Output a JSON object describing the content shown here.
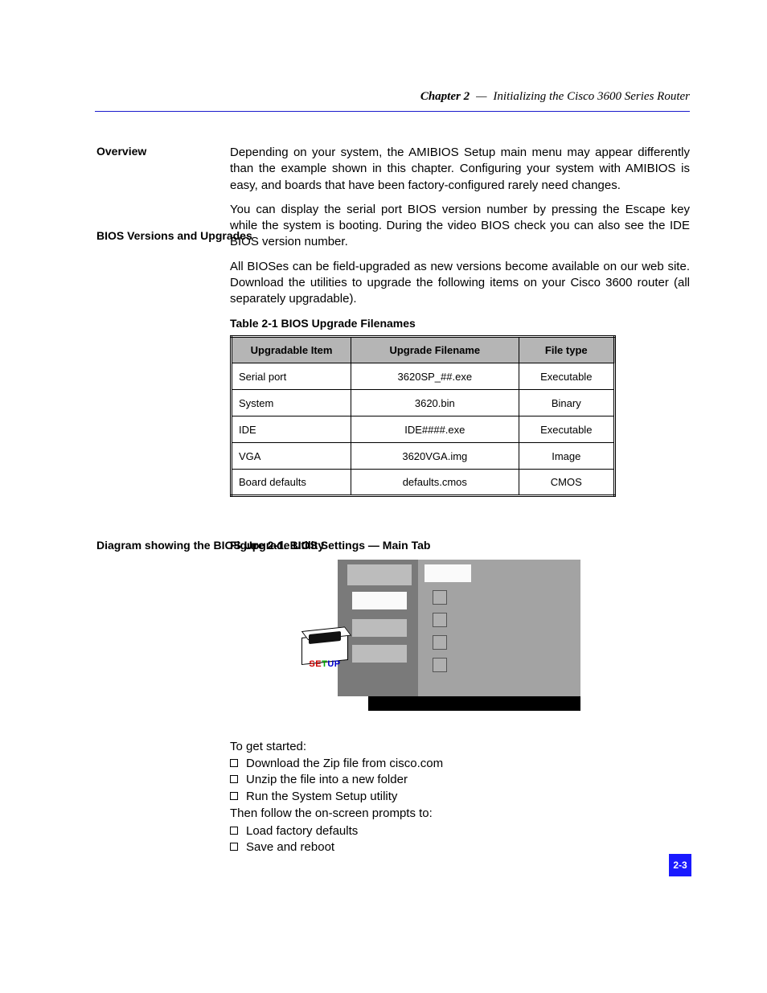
{
  "header": {
    "chapter": "Chapter 2",
    "sep": "—",
    "title": "Initializing the Cisco 3600 Series Router"
  },
  "labels": {
    "overview": "Overview",
    "bios": "BIOS Versions and Upgrades",
    "diagram": "Diagram showing the BIOS Upgrade Utility"
  },
  "paragraphs": {
    "p1": "Depending on your system, the AMIBIOS Setup main menu may appear differently than the example shown in this chapter. Configuring your system with AMIBIOS is easy, and boards that have been factory-configured rarely need changes.",
    "p2": "You can display the serial port BIOS version number by pressing the Escape key while the system is booting. During the video BIOS check you can also see the IDE BIOS version number.",
    "p3": "All BIOSes can be field-upgraded as new versions become available on our web site. Download the utilities to upgrade the following items on your Cisco 3600 router (all separately upgradable)."
  },
  "table": {
    "caption": "Table 2-1  BIOS Upgrade Filenames",
    "headers": [
      "Upgradable Item",
      "Upgrade Filename",
      "File type"
    ],
    "rows": [
      [
        "Serial port",
        "3620SP_##.exe",
        "Executable"
      ],
      [
        "System",
        "3620.bin",
        "Binary"
      ],
      [
        "IDE",
        "IDE####.exe",
        "Executable"
      ],
      [
        "VGA",
        "3620VGA.img",
        "Image"
      ],
      [
        "Board defaults",
        "defaults.cmos",
        "CMOS"
      ]
    ]
  },
  "diagram_title": "Figure 2-1.  BIOS Settings — Main Tab",
  "setup_label": "SETUP",
  "bullets": {
    "intro": "To get started:",
    "group1": [
      "Download the Zip file from cisco.com",
      "Unzip the file into a new folder",
      "Run the System Setup utility"
    ],
    "line_after1": "Then follow the on-screen prompts to:",
    "group2": [
      "Load factory defaults",
      "Save and reboot"
    ]
  },
  "page_number": "2-3"
}
